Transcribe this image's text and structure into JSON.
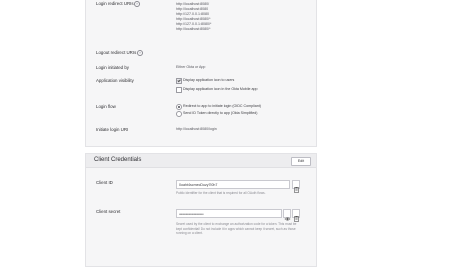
{
  "upper": {
    "login_redirect_label": "Login redirect URIs",
    "login_redirect_uris": [
      "http://localhost:8080/",
      "http://localhost:8080",
      "http://127.0.0.1:8080",
      "http://localhost:8080/*",
      "http://127.0.0.1:8080/*",
      "http://localhost:8080/*"
    ],
    "logout_redirect_label": "Logout redirect URIs",
    "login_initiated_label": "Login initiated by",
    "login_initiated_value": "Either Okta or App",
    "app_visibility_label": "Application visibility",
    "visibility_options": [
      "Display application icon to users",
      "Display application icon in the Okta Mobile app"
    ],
    "login_flow_label": "Login flow",
    "login_flow_options": [
      "Redirect to app to initiate login (OIDC Compliant)",
      "Send ID Token directly to app (Okta Simplified)"
    ],
    "initiate_login_label": "Initiate login URI",
    "initiate_login_value": "http://localhost:8080/login"
  },
  "creds": {
    "title": "Client Credentials",
    "edit_label": "Edit",
    "client_id_label": "Client ID",
    "client_id_value": "0oaht4scmecDuzy7l0h7",
    "client_id_help": "Public identifier for the client that is required for all OAuth flows.",
    "client_secret_label": "Client secret",
    "client_secret_value": "••••••••••••••••••••••••••••••••••••••••",
    "client_secret_help": "Secret used by the client to exchange an authorization code for a token. This must be kept confidential! Do not include it in apps which cannot keep it secret, such as those running on a client."
  }
}
